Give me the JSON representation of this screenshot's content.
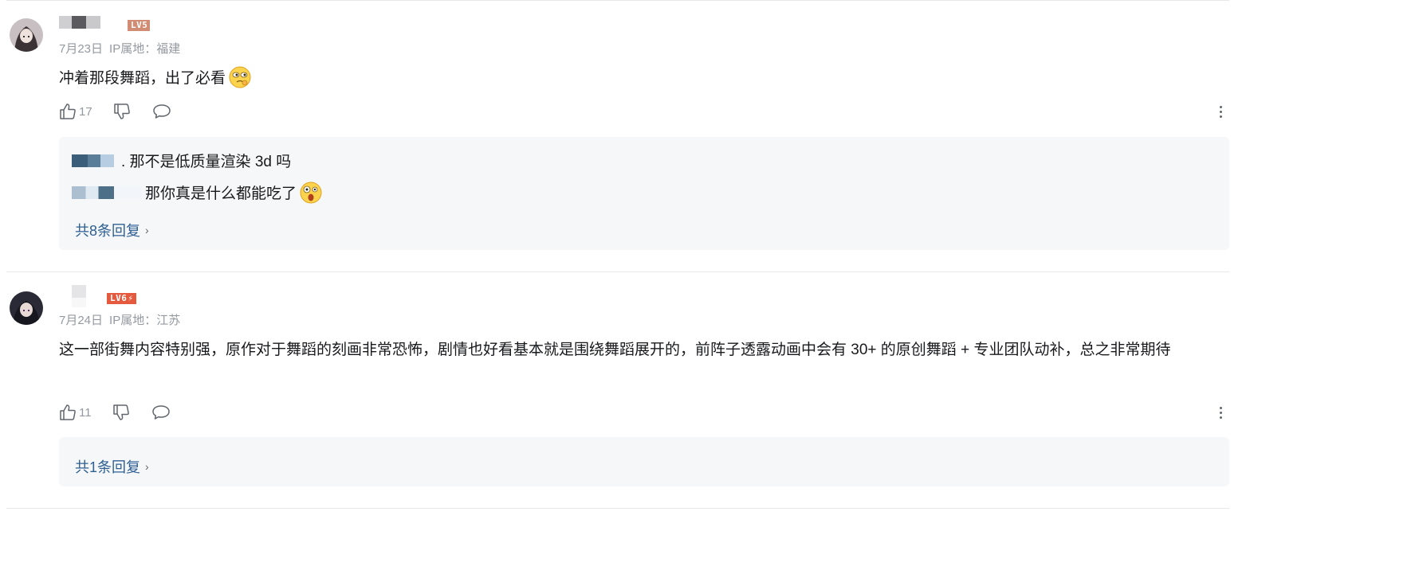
{
  "comments": [
    {
      "level": "LV5",
      "date": "7月23日",
      "ip": "IP属地：福建",
      "text": "冲着那段舞蹈，出了必看",
      "likes": "17",
      "emoji": "thinking-emoji",
      "replies": [
        {
          "text": ". 那不是低质量渲染 3d 吗"
        },
        {
          "text": "那你真是什么都能吃了",
          "emoji": "shocked-emoji"
        }
      ],
      "reply_link": "共8条回复"
    },
    {
      "level": "LV6",
      "date": "7月24日",
      "ip": "IP属地：江苏",
      "text": "这一部街舞内容特别强，原作对于舞蹈的刻画非常恐怖，剧情也好看基本就是围绕舞蹈展开的，前阵子透露动画中会有 30+ 的原创舞蹈 + 专业团队动补，总之非常期待",
      "likes": "11",
      "reply_link": "共1条回复"
    }
  ],
  "colors": {
    "meta": "#9499a0",
    "link": "#2e5f93",
    "reply_bg": "#f6f7f8",
    "lv5": "#d18c73",
    "lv6": "#e55a3f"
  },
  "icons": {
    "like": "thumbs-up-icon",
    "dislike": "thumbs-down-icon",
    "reply": "speech-bubble-icon",
    "more": "more-vertical-icon",
    "chevron": "chevron-right-icon"
  }
}
